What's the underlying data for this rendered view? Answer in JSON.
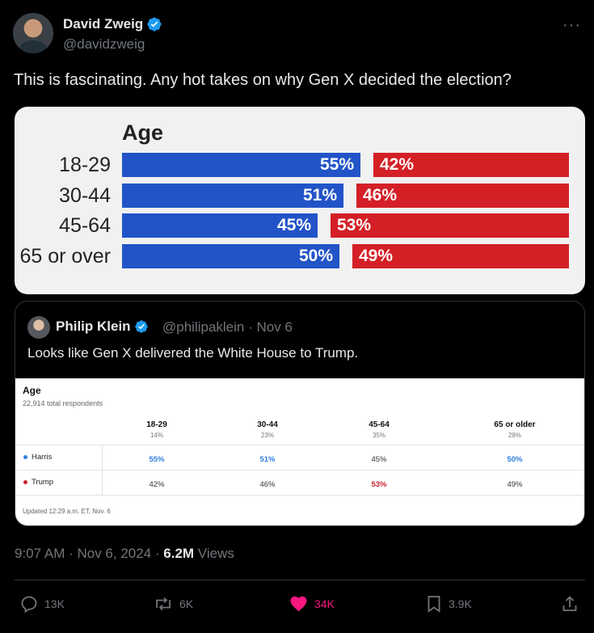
{
  "author": {
    "name": "David Zweig",
    "handle": "@davidzweig"
  },
  "tweet_text": "This is fascinating. Any hot takes on why Gen X decided the election?",
  "chart_data": {
    "type": "bar",
    "title": "Age",
    "categories": [
      "18-29",
      "30-44",
      "45-64",
      "65 or over"
    ],
    "series": [
      {
        "values": [
          55,
          51,
          45,
          50
        ],
        "labels": [
          "55%",
          "51%",
          "45%",
          "50%"
        ],
        "color": "#2254c8"
      },
      {
        "values": [
          42,
          46,
          53,
          49
        ],
        "labels": [
          "42%",
          "46%",
          "53%",
          "49%"
        ],
        "color": "#d41f26"
      }
    ]
  },
  "quoted": {
    "name": "Philip Klein",
    "handle_date": "@philipaklein · Nov 6",
    "text": "Looks like Gen X delivered the White House to Trump.",
    "table": {
      "title": "Age",
      "subtitle": "22,914 total respondents",
      "columns": [
        {
          "label": "18-29",
          "pct": "14%"
        },
        {
          "label": "30-44",
          "pct": "23%"
        },
        {
          "label": "45-64",
          "pct": "35%"
        },
        {
          "label": "65 or older",
          "pct": "28%"
        }
      ],
      "rows": [
        {
          "candidate": "Harris",
          "color": "#2f7fe0",
          "values": [
            "55%",
            "51%",
            "45%",
            "50%"
          ]
        },
        {
          "candidate": "Trump",
          "color": "#c8222a",
          "values": [
            "42%",
            "46%",
            "53%",
            "49%"
          ]
        }
      ],
      "updated": "Updated 12:29 a.m. ET, Nov. 6"
    }
  },
  "meta": {
    "time": "9:07 AM · Nov 6, 2024 · ",
    "views_count": "6.2M",
    "views_label": " Views"
  },
  "actions": {
    "replies": "13K",
    "reposts": "6K",
    "likes": "34K",
    "bookmarks": "3.9K"
  },
  "colors": {
    "verified": "#1d9bf0",
    "like": "#f91880"
  }
}
